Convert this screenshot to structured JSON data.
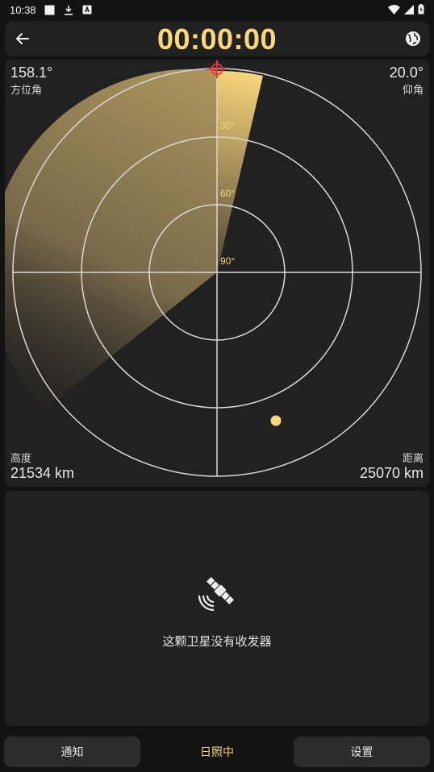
{
  "status_bar": {
    "time": "10:38",
    "left_icons": [
      "square-icon",
      "download-icon",
      "app-a-icon"
    ],
    "right_icons": [
      "wifi-icon",
      "signal-icon",
      "battery-icon"
    ]
  },
  "header": {
    "timer": "00:00:00",
    "back_icon": "arrow-left-icon",
    "globe_icon": "globe-icon"
  },
  "radar": {
    "azimuth_value": "158.1°",
    "azimuth_label": "方位角",
    "elevation_value": "20.0°",
    "elevation_label": "仰角",
    "altitude_label": "高度",
    "altitude_value": "21534 km",
    "distance_label": "距离",
    "distance_value": "25070 km",
    "ring_labels": [
      "30°",
      "60°",
      "90°"
    ],
    "accent_color": "#fbd77c"
  },
  "transmitter": {
    "icon": "satellite-icon",
    "message": "这颗卫星没有收发器"
  },
  "bottom_nav": {
    "notify_label": "通知",
    "sun_label": "日照中",
    "settings_label": "设置"
  }
}
